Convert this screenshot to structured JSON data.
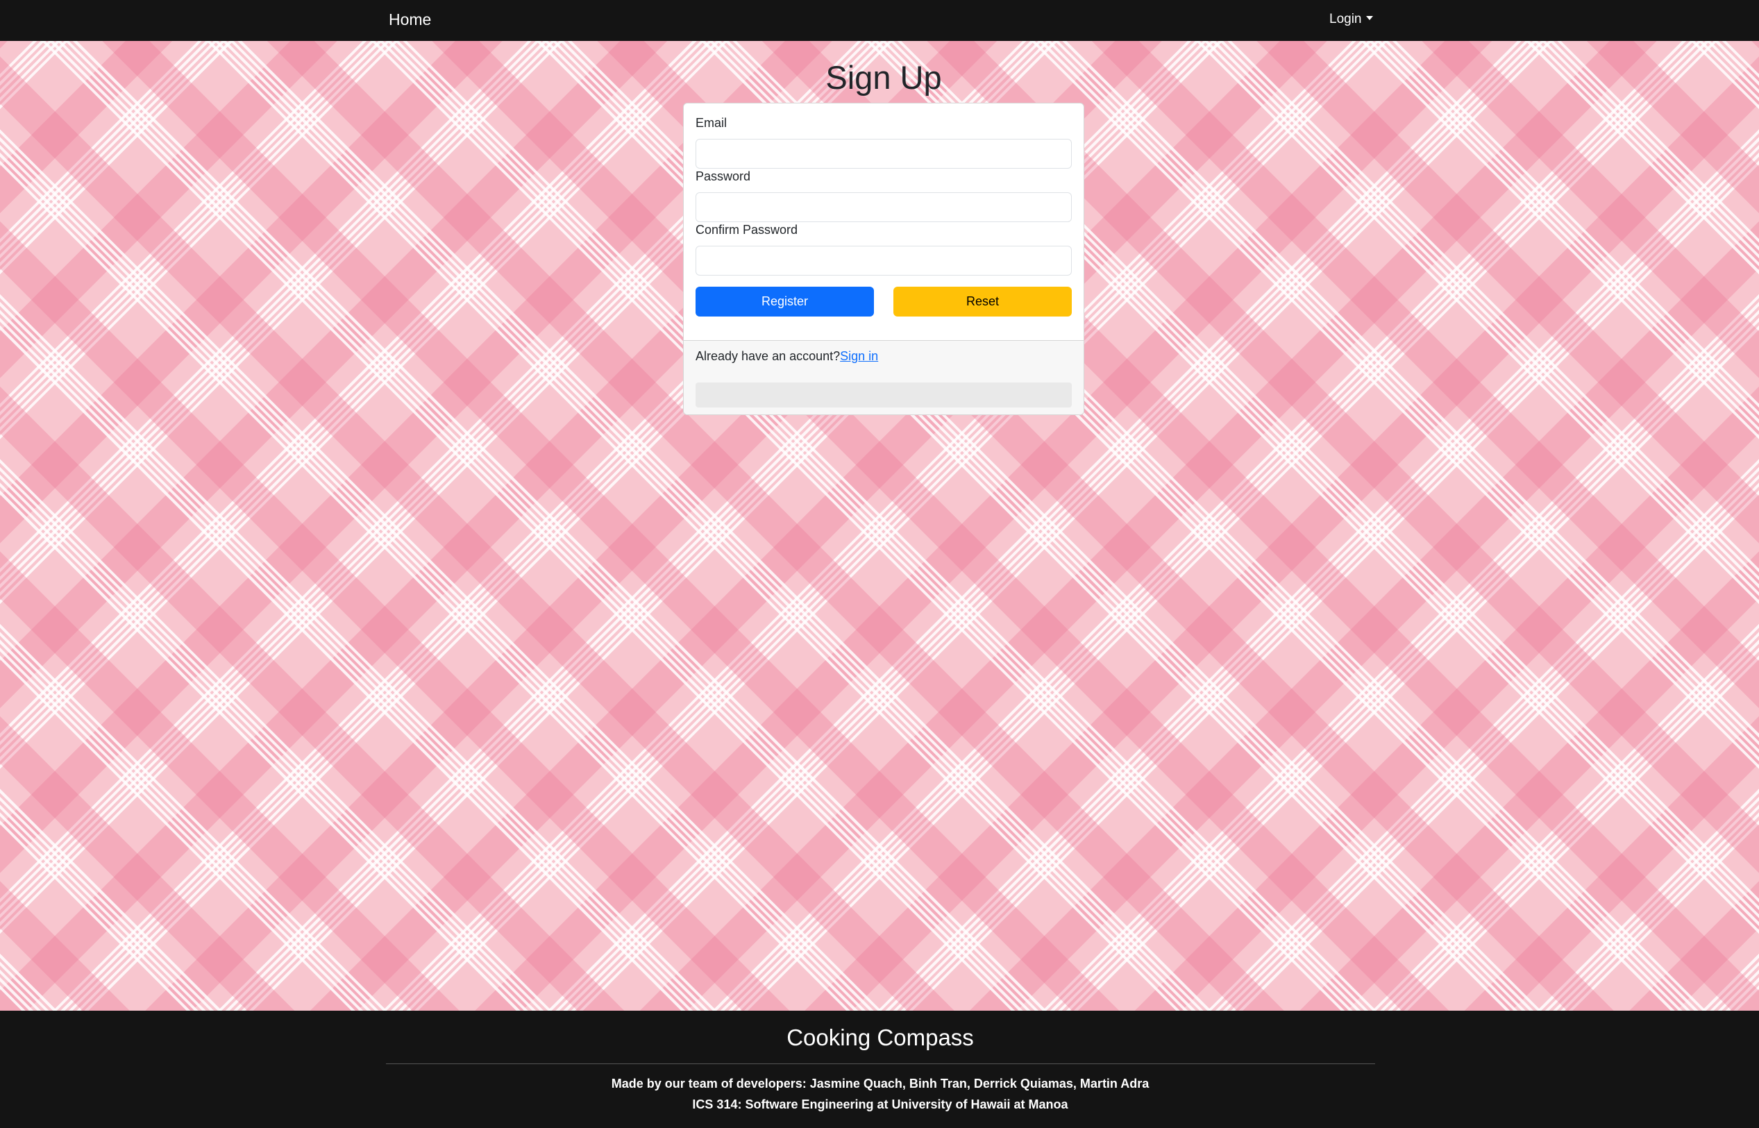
{
  "navbar": {
    "home_label": "Home",
    "login_label": "Login"
  },
  "page": {
    "title": "Sign Up"
  },
  "form": {
    "email_label": "Email",
    "email_value": "",
    "password_label": "Password",
    "password_value": "",
    "confirm_password_label": "Confirm Password",
    "confirm_password_value": "",
    "register_label": "Register",
    "reset_label": "Reset"
  },
  "card_footer": {
    "prompt_text": "Already have an account?",
    "signin_link": "Sign in"
  },
  "footer": {
    "brand": "Cooking Compass",
    "credits": "Made by our team of developers: Jasmine Quach, Binh Tran, Derrick Quiamas, Martin Adra",
    "course": "ICS 314: Software Engineering at University of Hawaii at Manoa"
  },
  "colors": {
    "navbar_bg": "#141414",
    "primary": "#0d6efd",
    "warning": "#ffc107",
    "background_pink": "#f8c6cf"
  },
  "icons": {
    "login_caret": "chevron-down-icon"
  }
}
